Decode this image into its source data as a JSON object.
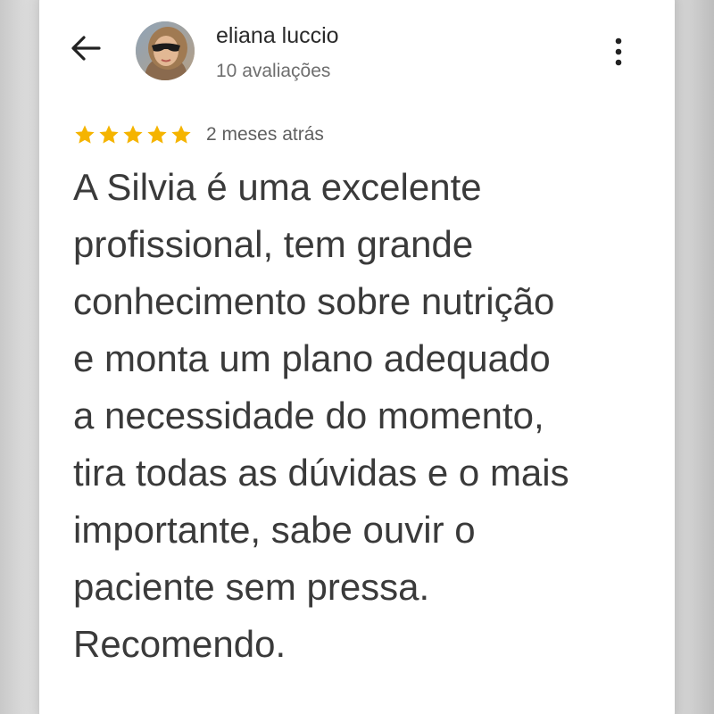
{
  "review": {
    "reviewer_name": "eliana luccio",
    "review_count": "10 avaliações",
    "rating": 5,
    "max_rating": 5,
    "date": "2 meses atrás",
    "text": "A Silvia é uma excelente\nprofissional, tem grande\nconhecimento sobre nutrição\ne monta um plano adequado\na necessidade do momento,\ntira todas as dúvidas e o mais\nimportante,  sabe ouvir o\npaciente sem pressa.\nRecomendo."
  },
  "icons": {
    "back": "arrow-left-icon",
    "more": "more-vertical-icon",
    "star": "star-icon",
    "avatar": "user-avatar"
  },
  "colors": {
    "star": "#F5B400",
    "name_text": "#2A2A2A",
    "secondary_text": "#6E6E6E",
    "body_text": "#3A3A3A",
    "card_background": "#FFFFFF"
  }
}
